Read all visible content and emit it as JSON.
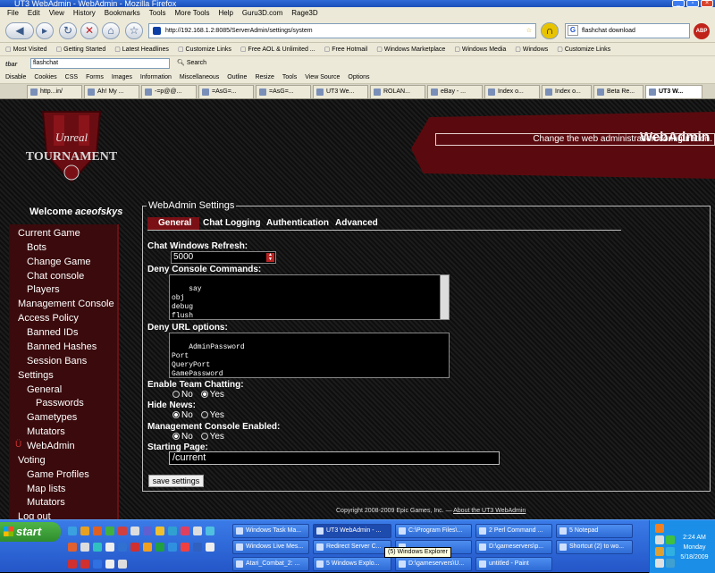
{
  "window": {
    "title": "UT3 WebAdmin - WebAdmin - Mozilla Firefox"
  },
  "menu": [
    "File",
    "Edit",
    "View",
    "History",
    "Bookmarks",
    "Tools",
    "More Tools",
    "Help",
    "Guru3D.com",
    "Rage3D"
  ],
  "nav": {
    "url": "http://192.168.1.2:8085/ServerAdmin/settings/system",
    "search_value": "flashchat download",
    "adblock_label": "ABP"
  },
  "bookmarks": [
    "Most Visited",
    "Getting Started",
    "Latest Headlines",
    "Customize Links",
    "Free AOL & Unlimited ...",
    "Free Hotmail",
    "Windows Marketplace",
    "Windows Media",
    "Windows",
    "Customize Links"
  ],
  "toolbar2": {
    "brand": "tbar",
    "field_value": "flashchat",
    "search_label": "Search"
  },
  "webdev": [
    "Disable",
    "Cookies",
    "CSS",
    "Forms",
    "Images",
    "Information",
    "Miscellaneous",
    "Outline",
    "Resize",
    "Tools",
    "View Source",
    "Options"
  ],
  "tabs": [
    "http...in/",
    "Ah! My ...",
    "-=p@@...",
    "=AsG=...",
    "=AsG=...",
    "UT3 We...",
    "ROLAN...",
    "eBay - ...",
    "Index o...",
    "Index o...",
    "Beta Re...",
    "UT3 W..."
  ],
  "header": {
    "logo_line1": "Unreal",
    "logo_line2": "TOURNAMENT",
    "title": "WebAdmin",
    "subtitle": "Change the web administration configuration."
  },
  "welcome": {
    "prefix": "Welcome",
    "user": "aceofskys"
  },
  "sidebar": [
    "Current Game",
    "Bots",
    "Change Game",
    "Chat console",
    "Players",
    "Management Console",
    "Access Policy",
    "Banned IDs",
    "Banned Hashes",
    "Session Bans",
    "Settings",
    "General",
    "Passwords",
    "Gametypes",
    "Mutators",
    "WebAdmin",
    "Voting",
    "Game Profiles",
    "Map lists",
    "Mutators",
    "Log out"
  ],
  "panel": {
    "legend": "WebAdmin Settings",
    "tabs": [
      "General",
      "Chat Logging",
      "Authentication",
      "Advanced"
    ],
    "chat_refresh_label": "Chat Windows Refresh:",
    "chat_refresh_value": "5000",
    "deny_console_label": "Deny Console Commands:",
    "deny_console_value": "say\nobj\ndebug\nflush\nset",
    "deny_url_label": "Deny URL options:",
    "deny_url_value": "AdminPassword\nPort\nQueryPort\nGamePassword",
    "team_chat_label": "Enable Team Chatting:",
    "hide_news_label": "Hide News:",
    "mgmt_console_label": "Management Console Enabled:",
    "no": "No",
    "yes": "Yes",
    "team_chat": "yes",
    "hide_news": "no",
    "mgmt_console": "no",
    "starting_page_label": "Starting Page:",
    "starting_page_value": "/current",
    "save_label": "save settings"
  },
  "footer": {
    "copyright": "Copyright 2008-2009 Epic Games, Inc. — ",
    "about": "About the UT3 WebAdmin"
  },
  "taskbar": {
    "start": "start",
    "row1": [
      "Windows Task Ma...",
      "UT3 WebAdmin - ...",
      "C:\\Program Files\\...",
      "2 Perl Command ...",
      "5 Notepad"
    ],
    "row2": [
      "Windows Live Mes...",
      "Redirect Server C...",
      "",
      "D:\\gameservers\\p...",
      "Shortcut (2) to wo..."
    ],
    "row3": [
      "Atari_Combat_2: ...",
      "5 Windows Explo...",
      "D:\\gameservers\\U...",
      "untitled - Paint"
    ],
    "tooltip": "(5) Windows Explorer",
    "time": "2:24 AM",
    "day": "Monday",
    "date": "5/18/2009"
  }
}
